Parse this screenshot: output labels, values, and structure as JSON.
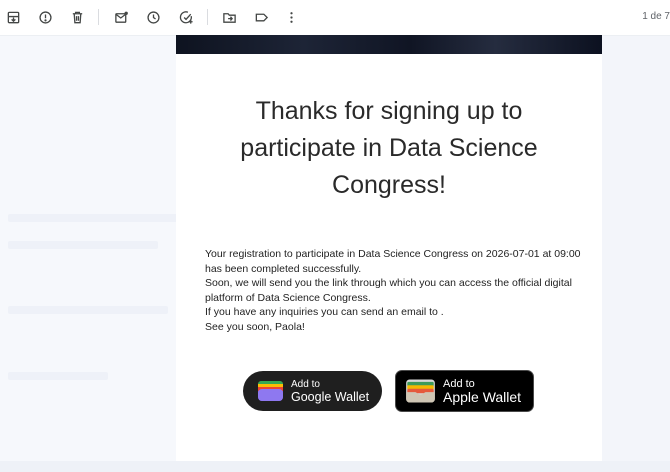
{
  "toolbar": {
    "icons": [
      "archive-icon",
      "report-spam-icon",
      "delete-icon",
      "mark-unread-icon",
      "snooze-icon",
      "add-task-icon",
      "move-to-icon",
      "label-icon",
      "more-vert-icon"
    ],
    "pager": "1 de 7"
  },
  "email": {
    "headline": "Thanks for signing up to participate in Data Science Congress!",
    "body": [
      "Your registration to participate in Data Science Congress on 2026-07-01 at 09:00 has been completed successfully.",
      "Soon, we will send you the link through which you can access the official digital platform of Data Science Congress.",
      "If you have any inquiries you can send an email to .",
      "See you soon, Paola!"
    ],
    "google_wallet": {
      "small": "Add to",
      "big": "Google Wallet"
    },
    "apple_wallet": {
      "small": "Add to",
      "big": "Apple Wallet"
    }
  },
  "colors": {
    "toolbar_icon": "#444746",
    "page_bg": "#f6f8fc",
    "button_bg": "#1f1f1f"
  }
}
